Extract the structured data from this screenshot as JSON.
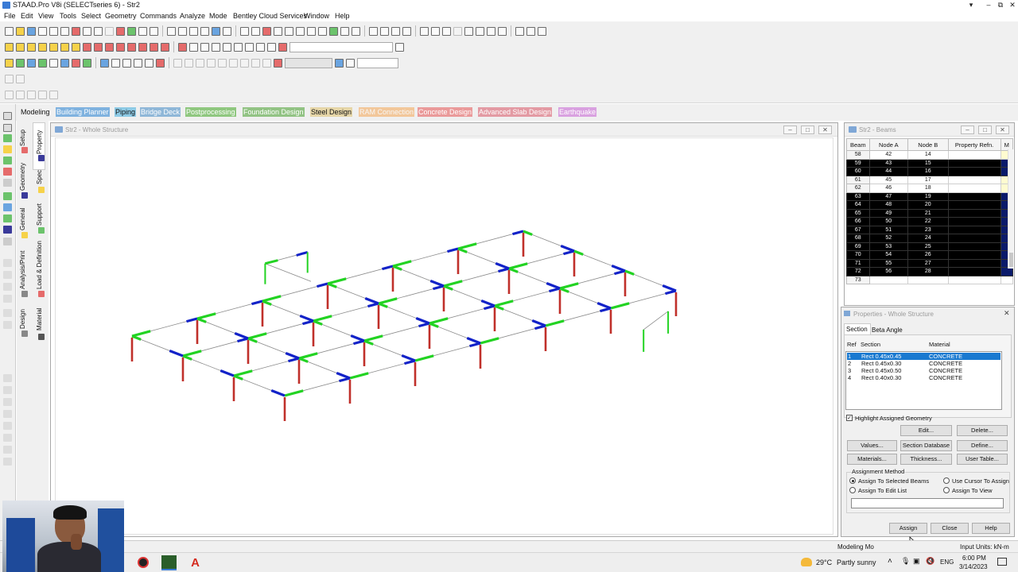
{
  "window": {
    "title": "STAAD.Pro V8i (SELECTseries 6) - Str2"
  },
  "menu": [
    "File",
    "Edit",
    "View",
    "Tools",
    "Select",
    "Geometry",
    "Commands",
    "Analyze",
    "Mode",
    "Bentley Cloud Services",
    "Window",
    "Help"
  ],
  "page_tabs": [
    {
      "label": "Modeling",
      "color": "#f0f0f0",
      "text": "#111111"
    },
    {
      "label": "Building Planner",
      "color": "#7fb2df",
      "text": "#ffffff"
    },
    {
      "label": "Piping",
      "color": "#8ecbe6",
      "text": "#111111"
    },
    {
      "label": "Bridge Deck",
      "color": "#8fb7d8",
      "text": "#ffffff"
    },
    {
      "label": "Postprocessing",
      "color": "#8fc77f",
      "text": "#ffffff"
    },
    {
      "label": "Foundation Design",
      "color": "#92c384",
      "text": "#ffffff"
    },
    {
      "label": "Steel Design",
      "color": "#e6d6a8",
      "text": "#111111"
    },
    {
      "label": "RAM Connection",
      "color": "#f2c79a",
      "text": "#f8f8f8"
    },
    {
      "label": "Concrete Design",
      "color": "#ea9a9a",
      "text": "#ffffff"
    },
    {
      "label": "Advanced Slab Design",
      "color": "#e39aa3",
      "text": "#ffffff"
    },
    {
      "label": "Earthquake",
      "color": "#d9a1e0",
      "text": "#ffffff"
    }
  ],
  "vertical_tabs_outer": [
    "Setup",
    "Geometry",
    "General",
    "Analysis/Print",
    "Design"
  ],
  "vertical_tabs_inner": [
    "Property",
    "Spec",
    "Support",
    "Load & Definition",
    "Material"
  ],
  "main_window": {
    "title": "Str2 - Whole Structure"
  },
  "beams_window": {
    "title": "Str2 - Beams",
    "columns": [
      "Beam",
      "Node A",
      "Node B",
      "Property Refn.",
      "M"
    ],
    "rows": [
      {
        "beam": "58",
        "a": "42",
        "b": "14",
        "hl": false
      },
      {
        "beam": "59",
        "a": "43",
        "b": "15",
        "hl": true
      },
      {
        "beam": "60",
        "a": "44",
        "b": "16",
        "hl": true
      },
      {
        "beam": "61",
        "a": "45",
        "b": "17",
        "hl": false
      },
      {
        "beam": "62",
        "a": "46",
        "b": "18",
        "hl": false
      },
      {
        "beam": "63",
        "a": "47",
        "b": "19",
        "hl": true
      },
      {
        "beam": "64",
        "a": "48",
        "b": "20",
        "hl": true
      },
      {
        "beam": "65",
        "a": "49",
        "b": "21",
        "hl": true
      },
      {
        "beam": "66",
        "a": "50",
        "b": "22",
        "hl": true
      },
      {
        "beam": "67",
        "a": "51",
        "b": "23",
        "hl": true
      },
      {
        "beam": "68",
        "a": "52",
        "b": "24",
        "hl": true
      },
      {
        "beam": "69",
        "a": "53",
        "b": "25",
        "hl": true
      },
      {
        "beam": "70",
        "a": "54",
        "b": "26",
        "hl": true
      },
      {
        "beam": "71",
        "a": "55",
        "b": "27",
        "hl": true
      },
      {
        "beam": "72",
        "a": "56",
        "b": "28",
        "hl": true
      },
      {
        "beam": "73",
        "a": "",
        "b": "",
        "hl": false
      }
    ]
  },
  "properties": {
    "title": "Properties - Whole Structure",
    "tabs": [
      "Section",
      "Beta Angle"
    ],
    "headers": [
      "Ref",
      "Section",
      "Material"
    ],
    "sections": [
      {
        "ref": "1",
        "section": "Rect 0.45x0.45",
        "material": "CONCRETE",
        "selected": true
      },
      {
        "ref": "2",
        "section": "Rect 0.45x0.30",
        "material": "CONCRETE",
        "selected": false
      },
      {
        "ref": "3",
        "section": "Rect 0.45x0.50",
        "material": "CONCRETE",
        "selected": false
      },
      {
        "ref": "4",
        "section": "Rect 0.40x0.30",
        "material": "CONCRETE",
        "selected": false
      }
    ],
    "highlight_label": "Highlight Assigned Geometry",
    "buttons": {
      "edit": "Edit...",
      "delete": "Delete...",
      "values": "Values...",
      "section_db": "Section Database",
      "define": "Define...",
      "materials": "Materials...",
      "thickness": "Thickness...",
      "user_table": "User Table...",
      "assign": "Assign",
      "close": "Close",
      "help": "Help"
    },
    "assignment": {
      "title": "Assignment Method",
      "sel_beams": "Assign To Selected Beams",
      "cursor": "Use Cursor To Assign",
      "edit_list": "Assign To Edit List",
      "view": "Assign To View"
    }
  },
  "status": {
    "mode": "Modeling Mo",
    "units": "Input Units:  kN-m"
  },
  "taskbar": {
    "weather_temp": "29°C",
    "weather_text": "Partly sunny",
    "lang": "ENG",
    "time": "6:00 PM",
    "date": "3/14/2023"
  },
  "colors": {
    "column": "#c0302a",
    "beam_z": "#1222c8",
    "beam_x": "#22d322",
    "line": "#8a8a8a",
    "select": "#1979d0"
  }
}
